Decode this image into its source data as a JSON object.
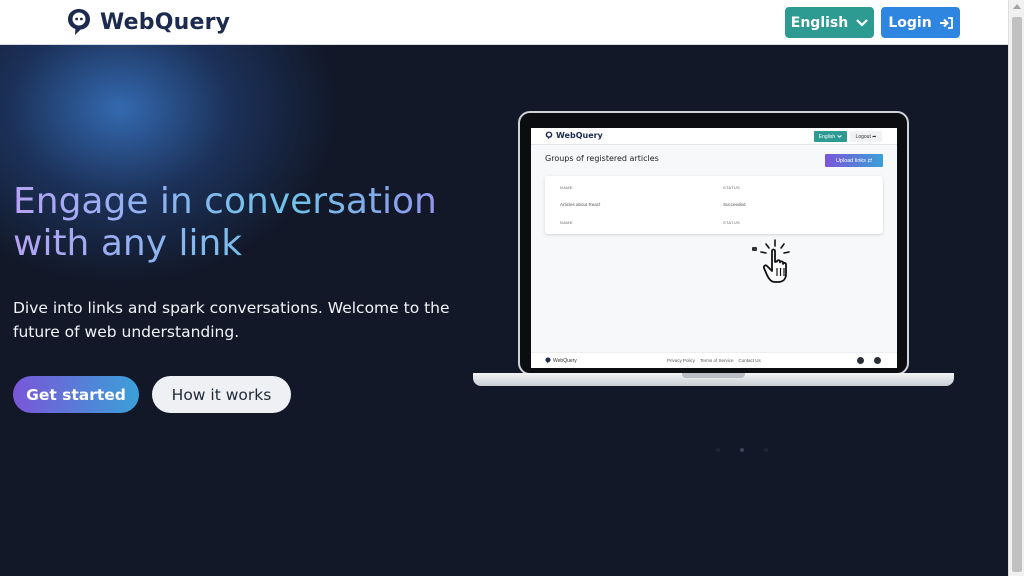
{
  "header": {
    "brand": "WebQuery",
    "language_button": "English",
    "login_button": "Login"
  },
  "hero": {
    "title_line1": "Engage in conversation",
    "title_line2": "with any link",
    "subtitle": "Dive into links and spark conversations. Welcome to the future of web understanding.",
    "get_started": "Get started",
    "how_it_works": "How it works"
  },
  "mockup": {
    "brand": "WebQuery",
    "language": "English",
    "logout": "Logout",
    "page_title": "Groups of registered articles",
    "upload_button": "Upload links",
    "table": {
      "col_name": "NAME",
      "col_status": "STATUS",
      "row_name": "Articles about React",
      "row_status": "Succeeded"
    },
    "footer": {
      "brand": "WebQuery",
      "links": [
        "Privacy Policy",
        "Terms of Service",
        "Contact Us"
      ]
    }
  },
  "carousel": {
    "total": 3,
    "active_index": 1
  },
  "colors": {
    "page_bg": "#121828",
    "brand_text": "#1b2a4e",
    "language_button": "#2e9b93",
    "login_button": "#2f86e0",
    "gradient_start": "#7a56d8",
    "gradient_end": "#3aa0d8"
  },
  "icons": {
    "brand": "chat-bubble-icon",
    "language_caret": "chevron-down-icon",
    "login": "sign-in-icon",
    "cursor": "pointer-hand-icon"
  }
}
